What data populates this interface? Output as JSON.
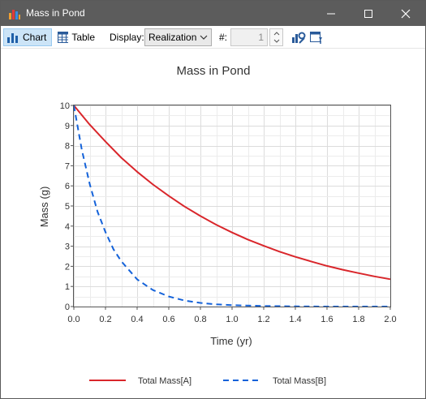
{
  "window": {
    "title": "Mass in Pond",
    "controls": [
      "minimize",
      "maximize",
      "close"
    ]
  },
  "toolbar": {
    "chart_label": "Chart",
    "table_label": "Table",
    "display_label": "Display:",
    "display_value": "Realization",
    "number_label": "#:",
    "realization_number": "1",
    "icons": [
      "chart-settings-icon",
      "chart-style-icon"
    ]
  },
  "colors": {
    "titlebar": "#5c5c5c",
    "series_a": "#d9262b",
    "series_b": "#1462d9",
    "grid": "#dddddd"
  },
  "chart_data": {
    "type": "line",
    "title": "Mass in Pond",
    "xlabel": "Time (yr)",
    "ylabel": "Mass (g)",
    "xlim": [
      0,
      2
    ],
    "ylim": [
      0,
      10
    ],
    "xticks": [
      "0.0",
      "0.2",
      "0.4",
      "0.6",
      "0.8",
      "1.0",
      "1.2",
      "1.4",
      "1.6",
      "1.8",
      "2.0"
    ],
    "yticks": [
      "0",
      "1",
      "2",
      "3",
      "4",
      "5",
      "6",
      "7",
      "8",
      "9",
      "10"
    ],
    "grid": true,
    "legend": "bottom",
    "series": [
      {
        "name": "Total Mass[A]",
        "style": "solid",
        "x": [
          0,
          0.1,
          0.2,
          0.3,
          0.4,
          0.5,
          0.6,
          0.7,
          0.8,
          0.9,
          1.0,
          1.1,
          1.2,
          1.3,
          1.4,
          1.5,
          1.6,
          1.7,
          1.8,
          1.9,
          2.0
        ],
        "values": [
          10,
          9.05,
          8.2,
          7.4,
          6.7,
          6.07,
          5.5,
          4.97,
          4.5,
          4.07,
          3.68,
          3.33,
          3.02,
          2.73,
          2.47,
          2.24,
          2.02,
          1.83,
          1.66,
          1.5,
          1.36
        ]
      },
      {
        "name": "Total Mass[B]",
        "style": "dashed",
        "x": [
          0,
          0.05,
          0.1,
          0.15,
          0.2,
          0.25,
          0.3,
          0.4,
          0.5,
          0.6,
          0.7,
          0.8,
          0.9,
          1.0,
          1.2,
          1.4,
          1.6,
          1.8,
          2.0
        ],
        "values": [
          10,
          7.8,
          6.1,
          4.7,
          3.7,
          2.85,
          2.25,
          1.35,
          0.82,
          0.5,
          0.3,
          0.18,
          0.11,
          0.07,
          0.03,
          0.01,
          0.0,
          0.0,
          0.0
        ]
      }
    ]
  }
}
